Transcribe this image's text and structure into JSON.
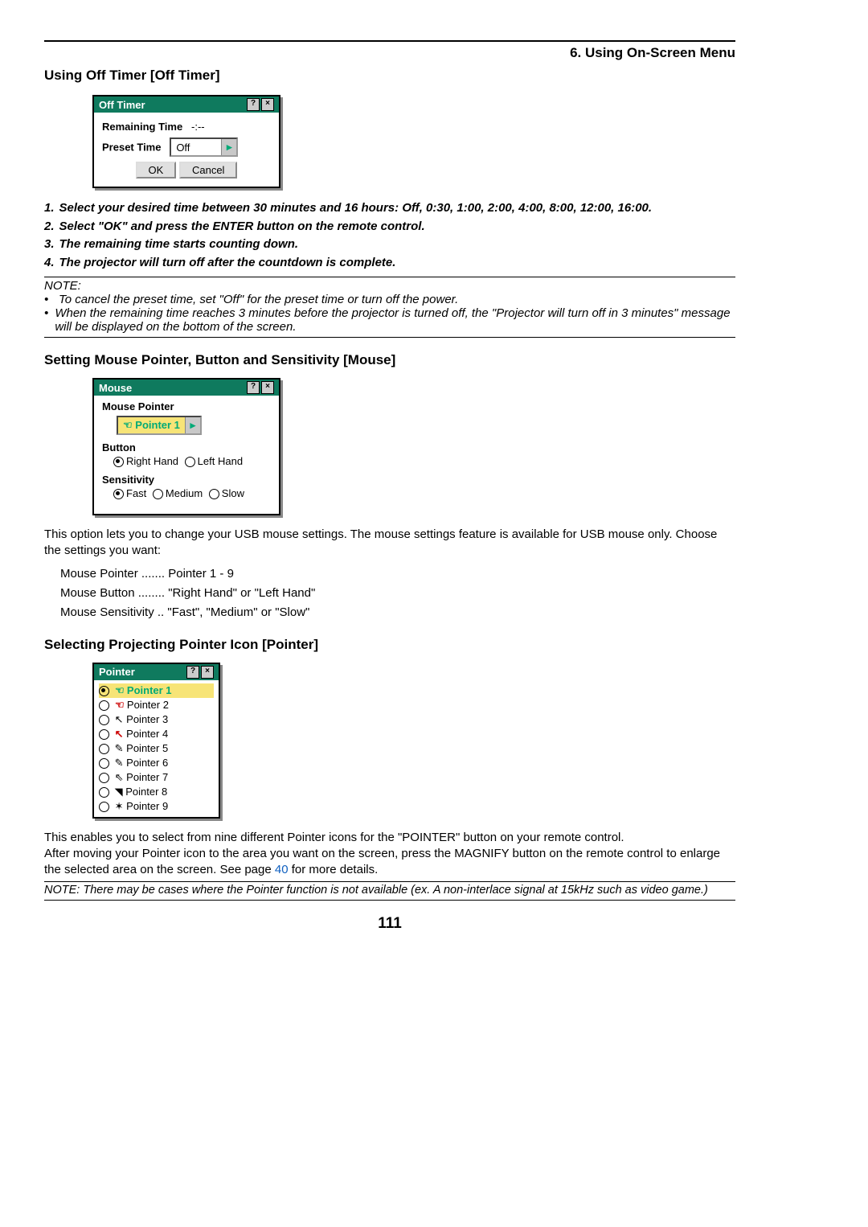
{
  "chapter": "6. Using On-Screen Menu",
  "s1": {
    "heading": "Using Off Timer [Off Timer]",
    "dlg": {
      "title": "Off Timer",
      "remaining_lbl": "Remaining Time",
      "remaining_val": "-:--",
      "preset_lbl": "Preset Time",
      "preset_val": "Off",
      "ok": "OK",
      "cancel": "Cancel"
    },
    "steps": [
      "Select your desired time between 30 minutes and 16 hours: Off, 0:30, 1:00, 2:00, 4:00, 8:00, 12:00, 16:00.",
      "Select \"OK\" and press the ENTER button on the remote control.",
      "The remaining time starts counting down.",
      "The projector will turn off after the countdown is complete."
    ],
    "note_lbl": "NOTE:",
    "note1": "To cancel the preset time, set \"Off\" for the preset time or turn off the power.",
    "note2": "When the remaining time reaches 3 minutes before the projector is turned off, the \"Projector will turn off in 3 minutes\" message will be displayed on the bottom of the screen."
  },
  "s2": {
    "heading": "Setting Mouse Pointer, Button and Sensitivity [Mouse]",
    "dlg": {
      "title": "Mouse",
      "mp_lbl": "Mouse Pointer",
      "mp_val": "Pointer 1",
      "btn_lbl": "Button",
      "btn_r": "Right Hand",
      "btn_l": "Left Hand",
      "sens_lbl": "Sensitivity",
      "sens_f": "Fast",
      "sens_m": "Medium",
      "sens_s": "Slow"
    },
    "para": "This option lets you to change your USB mouse settings. The mouse settings feature is available for USB mouse only. Choose the settings you want:",
    "list": {
      "l1": "Mouse Pointer ....... Pointer 1 - 9",
      "l2": "Mouse Button ........ \"Right Hand\" or \"Left Hand\"",
      "l3": "Mouse Sensitivity .. \"Fast\", \"Medium\" or \"Slow\""
    }
  },
  "s3": {
    "heading": "Selecting Projecting Pointer Icon [Pointer]",
    "dlg_title": "Pointer",
    "ptrs": [
      "Pointer 1",
      "Pointer 2",
      "Pointer 3",
      "Pointer 4",
      "Pointer 5",
      "Pointer 6",
      "Pointer 7",
      "Pointer 8",
      "Pointer 9"
    ],
    "p1": "This enables you to select from nine different Pointer icons for the \"POINTER\" button on your remote control.",
    "p2a": "After moving your Pointer icon to the area you want on the screen, press the MAGNIFY button on the remote control to enlarge the selected area on the screen. See page ",
    "p2_link": "40",
    "p2b": " for more details.",
    "footer_note": "NOTE: There may be cases where the Pointer function is not available (ex. A non-interlace signal at 15kHz such as video game.)"
  },
  "page_num": "111"
}
